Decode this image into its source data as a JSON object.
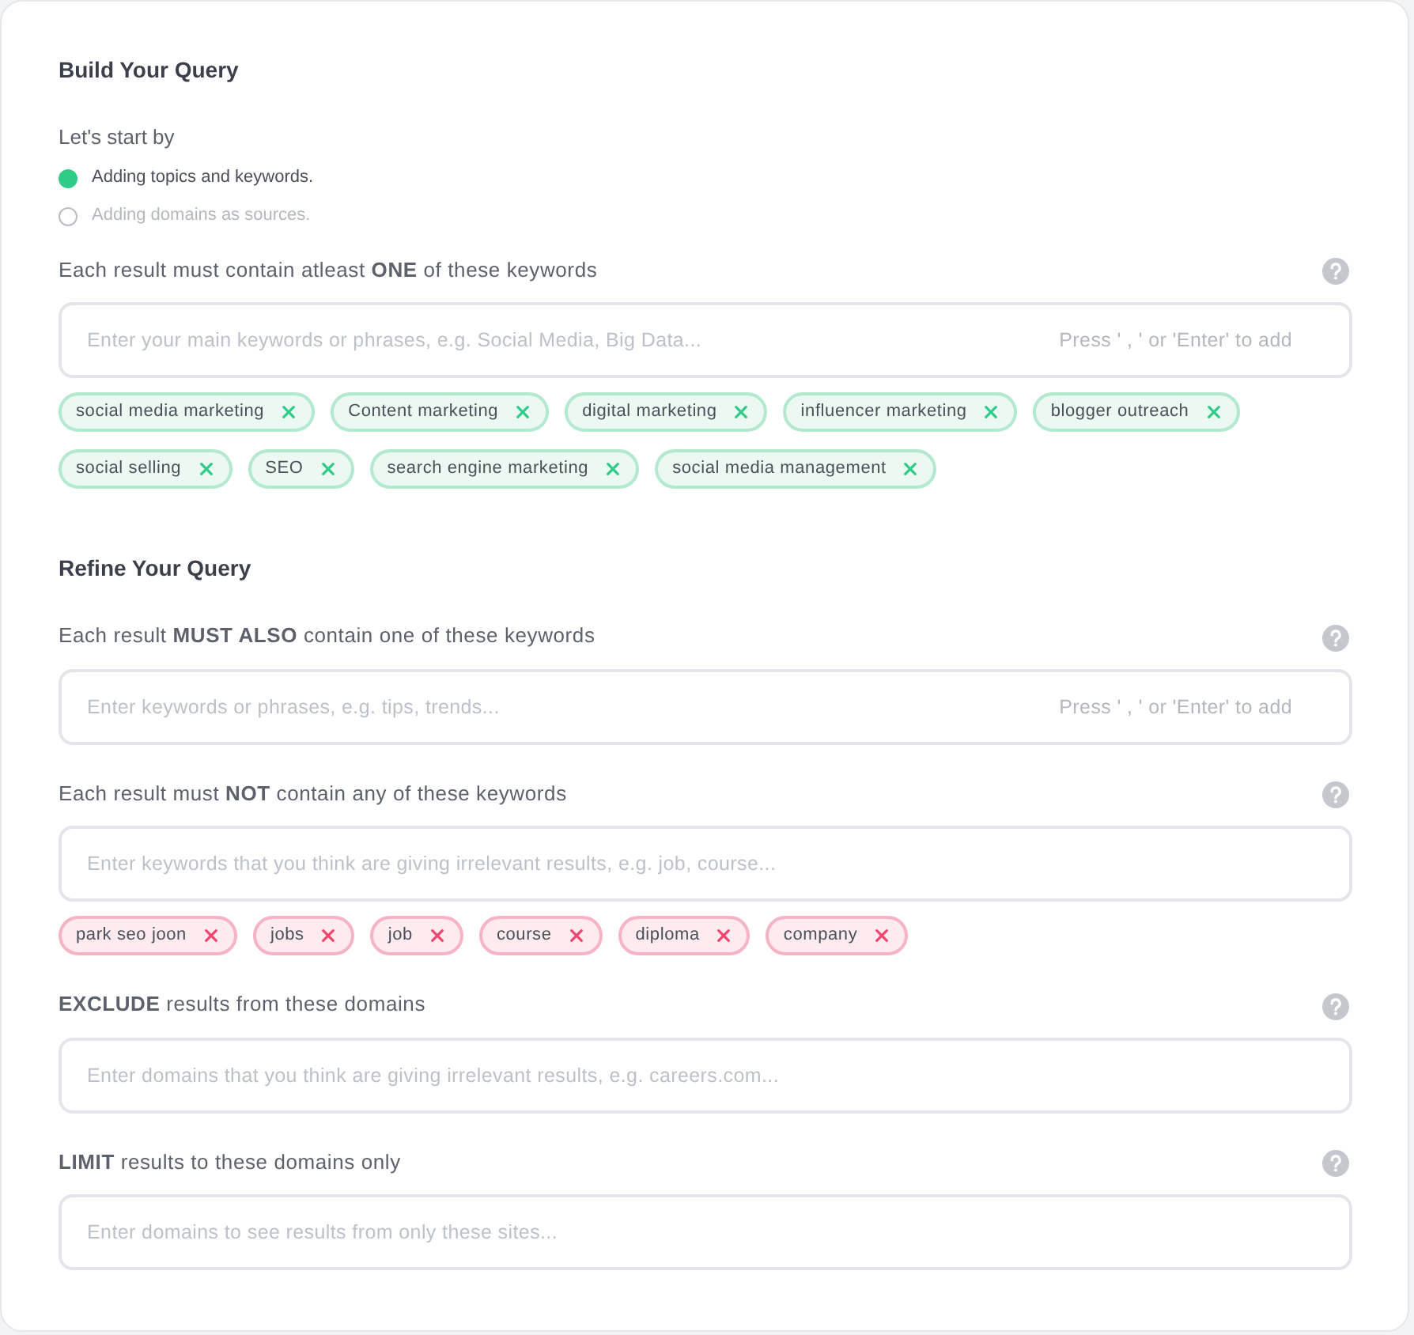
{
  "build": {
    "title": "Build Your Query",
    "intro": "Let's start by",
    "options": [
      {
        "label": "Adding topics and keywords.",
        "selected": true
      },
      {
        "label": "Adding domains as sources.",
        "selected": false
      }
    ],
    "fields": [
      {
        "label": "Each result must contain atleast **ONE** of these keywords",
        "placeholder": "Enter your main keywords or phrases, e.g. Social Media, Big Data...",
        "hint": "Press ' , ' or 'Enter' to add",
        "kind": "include",
        "tags": [
          "social media marketing",
          "Content marketing",
          "digital marketing",
          "influencer marketing",
          "blogger outreach",
          "social selling",
          "SEO",
          "search engine marketing",
          "social media management"
        ]
      }
    ]
  },
  "refine": {
    "title": "Refine Your Query",
    "fields": [
      {
        "label": "Each result **MUST ALSO** contain one of these keywords",
        "placeholder": "Enter keywords or phrases, e.g. tips, trends...",
        "hint": "Press ' , ' or 'Enter' to add"
      },
      {
        "label": "Each result must **NOT** contain any of these keywords",
        "placeholder": "Enter keywords that you think are giving irrelevant results, e.g. job, course...",
        "kind": "exclude",
        "tags": [
          "park seo joon",
          "jobs",
          "job",
          "course",
          "diploma",
          "company"
        ]
      },
      {
        "label": "**EXCLUDE** results from these domains",
        "placeholder": "Enter domains that you think are giving irrelevant results, e.g. careers.com..."
      },
      {
        "label": "**LIMIT** results to these domains only",
        "placeholder": "Enter domains to see results from only these sites..."
      }
    ]
  }
}
